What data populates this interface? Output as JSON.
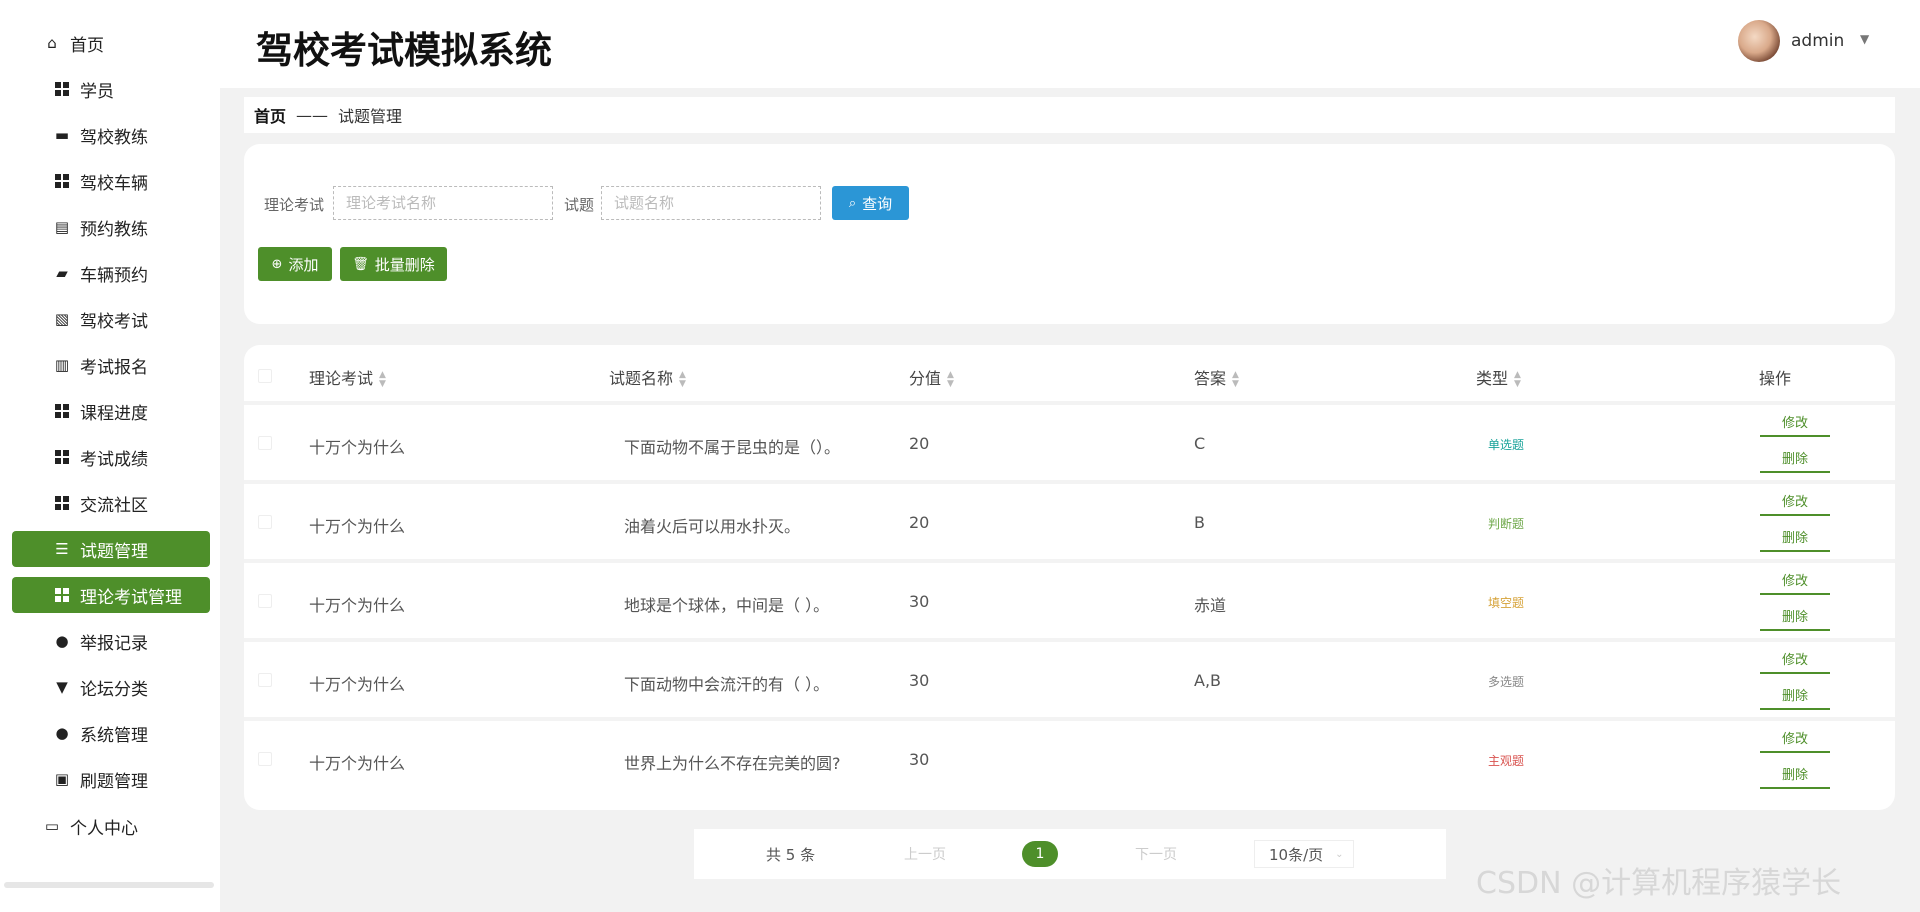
{
  "app_title": "驾校考试模拟系统",
  "user": {
    "name": "admin"
  },
  "sidebar": {
    "home": "首页",
    "items": [
      {
        "label": "学员",
        "icon": "grid-icon"
      },
      {
        "label": "驾校教练",
        "icon": "monitor-icon"
      },
      {
        "label": "驾校车辆",
        "icon": "grid-icon"
      },
      {
        "label": "预约教练",
        "icon": "clipboard-icon"
      },
      {
        "label": "车辆预约",
        "icon": "wallet-icon"
      },
      {
        "label": "驾校考试",
        "icon": "clipboard-x-icon"
      },
      {
        "label": "考试报名",
        "icon": "books-icon"
      },
      {
        "label": "课程进度",
        "icon": "grid-icon"
      },
      {
        "label": "考试成绩",
        "icon": "grid-icon"
      },
      {
        "label": "交流社区",
        "icon": "grid-icon"
      },
      {
        "label": "试题管理",
        "icon": "sliders-icon"
      },
      {
        "label": "理论考试管理",
        "icon": "grid-icon"
      },
      {
        "label": "举报记录",
        "icon": "user-icon"
      },
      {
        "label": "论坛分类",
        "icon": "pin-icon"
      },
      {
        "label": "系统管理",
        "icon": "user-icon"
      },
      {
        "label": "刷题管理",
        "icon": "clipboard-check-icon"
      }
    ],
    "profile": "个人中心"
  },
  "breadcrumb": {
    "home": "首页",
    "sep": "——",
    "current": "试题管理"
  },
  "search": {
    "exam_label": "理论考试",
    "exam_placeholder": "理论考试名称",
    "question_label": "试题",
    "question_placeholder": "试题名称",
    "query_label": "查询"
  },
  "actions": {
    "add": "添加",
    "batch_delete": "批量删除"
  },
  "table": {
    "headers": [
      "理论考试",
      "试题名称",
      "分值",
      "答案",
      "类型",
      "操作"
    ],
    "edit_label": "修改",
    "delete_label": "删除",
    "rows": [
      {
        "exam": "十万个为什么",
        "question": "下面动物不属于昆虫的是（）。",
        "score": "20",
        "answer": "C",
        "type": "单选题",
        "type_color": "#1aa39a"
      },
      {
        "exam": "十万个为什么",
        "question": "油着火后可以用水扑灭。",
        "score": "20",
        "answer": "B",
        "type": "判断题",
        "type_color": "#6fa84a"
      },
      {
        "exam": "十万个为什么",
        "question": "地球是个球体，中间是（ ）。",
        "score": "30",
        "answer": "赤道",
        "type": "填空题",
        "type_color": "#d6a33a"
      },
      {
        "exam": "十万个为什么",
        "question": "下面动物中会流汗的有（ ）。",
        "score": "30",
        "answer": "A,B",
        "type": "多选题",
        "type_color": "#888888"
      },
      {
        "exam": "十万个为什么",
        "question": "世界上为什么不存在完美的圆?",
        "score": "30",
        "answer": "",
        "type": "主观题",
        "type_color": "#d9534f"
      }
    ]
  },
  "pagination": {
    "total": "共 5 条",
    "prev": "上一页",
    "current": "1",
    "next": "下一页",
    "page_size": "10条/页"
  },
  "watermark": "CSDN @计算机程序猿学长"
}
